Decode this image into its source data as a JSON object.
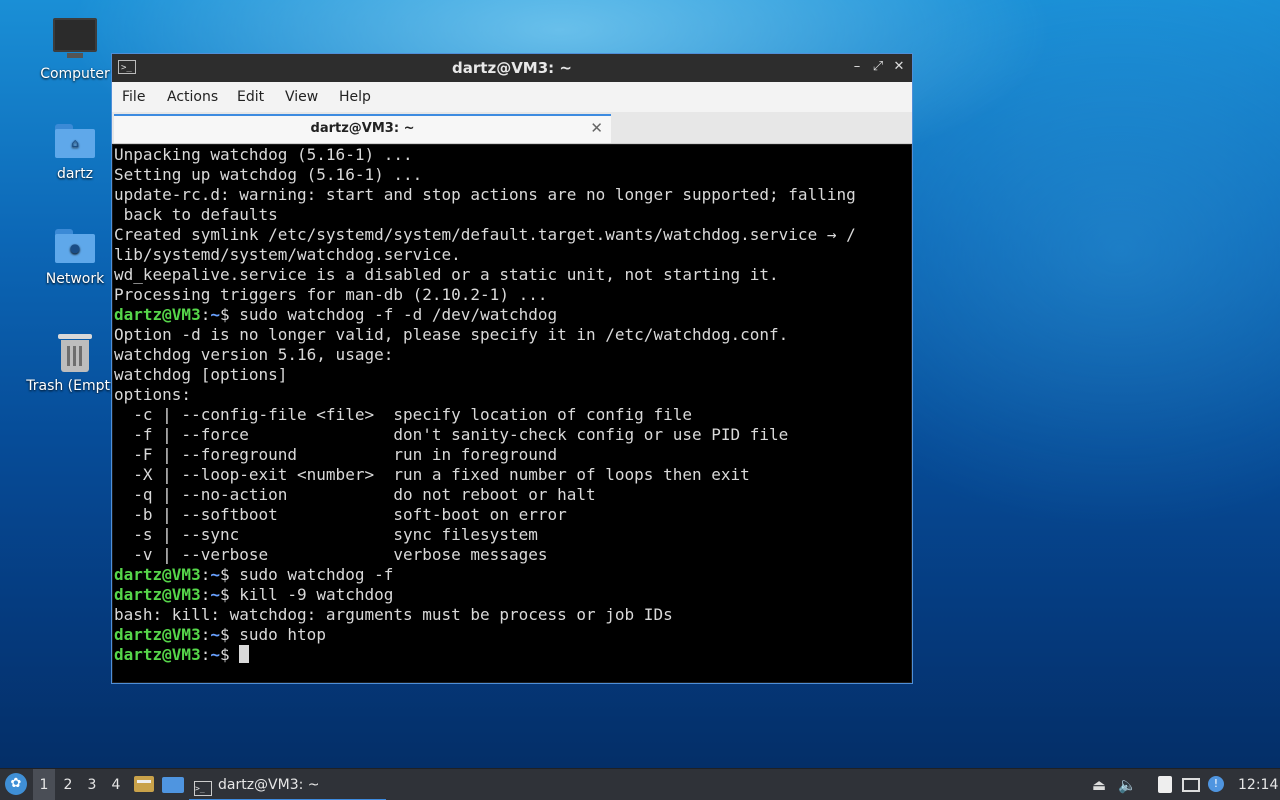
{
  "desktop": {
    "icons": [
      {
        "label": "Computer",
        "icon": "computer-icon"
      },
      {
        "label": "dartz",
        "icon": "home-folder-icon"
      },
      {
        "label": "Network",
        "icon": "network-folder-icon"
      },
      {
        "label": "Trash (Empty)",
        "icon": "trash-icon"
      }
    ]
  },
  "window": {
    "title": "dartz@VM3: ~",
    "controls": {
      "minimize": "–",
      "maximize": "⤢",
      "close": "✕"
    },
    "menu": [
      "File",
      "Actions",
      "Edit",
      "View",
      "Help"
    ],
    "tab": {
      "label": "dartz@VM3: ~",
      "close": "✕"
    }
  },
  "terminal": {
    "prompt_user": "dartz@VM3",
    "prompt_sep": ":",
    "prompt_path": "~",
    "prompt_end": "$ ",
    "lines": [
      "Unpacking watchdog (5.16-1) ...",
      "Setting up watchdog (5.16-1) ...",
      "update-rc.d: warning: start and stop actions are no longer supported; falling",
      " back to defaults",
      "Created symlink /etc/systemd/system/default.target.wants/watchdog.service → /",
      "lib/systemd/system/watchdog.service.",
      "wd_keepalive.service is a disabled or a static unit, not starting it.",
      "Processing triggers for man-db (2.10.2-1) ...",
      "sudo watchdog -f -d /dev/watchdog",
      "Option -d is no longer valid, please specify it in /etc/watchdog.conf.",
      "watchdog version 5.16, usage:",
      "watchdog [options]",
      "options:",
      "  -c | --config-file <file>  specify location of config file",
      "  -f | --force               don't sanity-check config or use PID file",
      "  -F | --foreground          run in foreground",
      "  -X | --loop-exit <number>  run a fixed number of loops then exit",
      "  -q | --no-action           do not reboot or halt",
      "  -b | --softboot            soft-boot on error",
      "  -s | --sync                sync filesystem",
      "  -v | --verbose             verbose messages",
      "sudo watchdog -f",
      "kill -9 watchdog",
      "bash: kill: watchdog: arguments must be process or job IDs",
      "sudo htop",
      ""
    ],
    "prompt_lines": [
      8,
      21,
      22,
      24,
      25
    ],
    "cursor_line": 25
  },
  "taskbar": {
    "start_icon": "lxqt-menu-icon",
    "workspaces": [
      "1",
      "2",
      "3",
      "4"
    ],
    "active_workspace": 0,
    "quicklaunch": [
      "file-manager-icon",
      "show-desktop-icon"
    ],
    "task": {
      "label": "dartz@VM3: ~",
      "icon": "terminal-icon"
    },
    "tray": [
      "eject-icon",
      "volume-icon",
      "clipboard-icon",
      "network-icon",
      "updates-icon"
    ],
    "clock": "12:14"
  },
  "colors": {
    "accent": "#3d8be0",
    "prompt_user": "#56d64a",
    "prompt_path": "#6aa2ff",
    "terminal_bg": "#000000",
    "terminal_fg": "#d9d9d9"
  }
}
